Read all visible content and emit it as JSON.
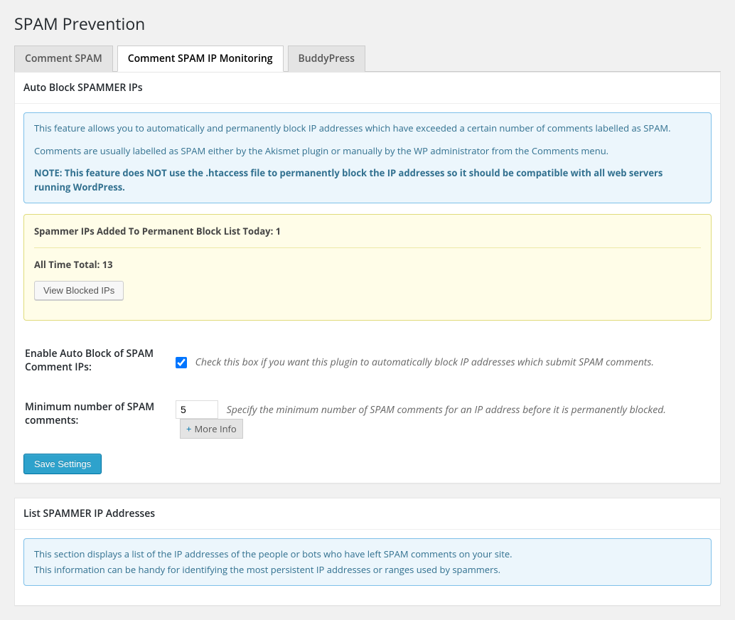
{
  "page": {
    "title": "SPAM Prevention"
  },
  "tabs": [
    {
      "label": "Comment SPAM"
    },
    {
      "label": "Comment SPAM IP Monitoring"
    },
    {
      "label": "BuddyPress"
    }
  ],
  "section1": {
    "title": "Auto Block SPAMMER IPs",
    "info": {
      "p1": "This feature allows you to automatically and permanently block IP addresses which have exceeded a certain number of comments labelled as SPAM.",
      "p2": "Comments are usually labelled as SPAM either by the Akismet plugin or manually by the WP administrator from the Comments menu.",
      "note": "NOTE: This feature does NOT use the .htaccess file to permanently block the IP addresses so it should be compatible with all web servers running WordPress."
    },
    "stats": {
      "today_label": "Spammer IPs Added To Permanent Block List Today: ",
      "today_value": "1",
      "alltime_label": "All Time Total: ",
      "alltime_value": "13",
      "view_button": "View Blocked IPs"
    },
    "form": {
      "enable_label": "Enable Auto Block of SPAM Comment IPs:",
      "enable_desc": "Check this box if you want this plugin to automatically block IP addresses which submit SPAM comments.",
      "min_label": "Minimum number of SPAM comments:",
      "min_value": "5",
      "min_desc": "Specify the minimum number of SPAM comments for an IP address before it is permanently blocked.",
      "more_info": "More Info",
      "save_button": "Save Settings"
    }
  },
  "section2": {
    "title": "List SPAMMER IP Addresses",
    "info": {
      "p1": "This section displays a list of the IP addresses of the people or bots who have left SPAM comments on your site.",
      "p2": "This information can be handy for identifying the most persistent IP addresses or ranges used by spammers."
    }
  }
}
